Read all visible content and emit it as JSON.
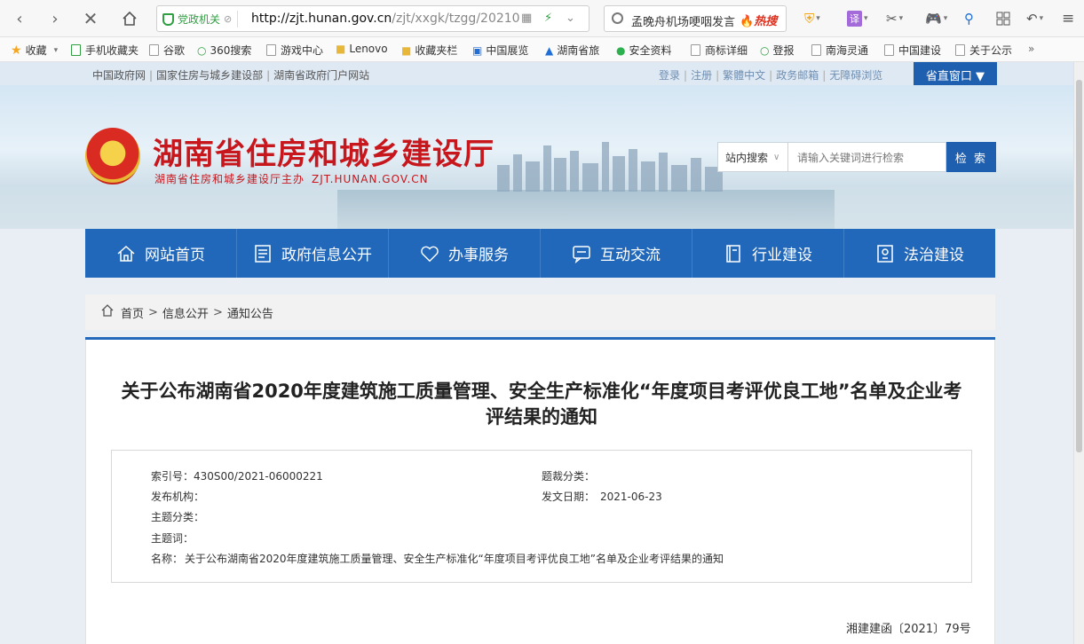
{
  "browser": {
    "address": {
      "badge": "党政机关",
      "url_host": "http://zjt.hunan.gov.cn",
      "url_path": "/zjt/xxgk/tzgg/20210"
    },
    "search": {
      "query": "孟晚舟机场哽咽发言",
      "hot_label": "热搜"
    },
    "tools": {
      "translate_label": "译"
    }
  },
  "bookmarks": [
    {
      "label": "收藏"
    },
    {
      "label": "手机收藏夹"
    },
    {
      "label": "谷歌"
    },
    {
      "label": "360搜索"
    },
    {
      "label": "游戏中心"
    },
    {
      "label": "Lenovo"
    },
    {
      "label": "收藏夹栏"
    },
    {
      "label": "中国展览"
    },
    {
      "label": "湖南省旅"
    },
    {
      "label": "安全资料"
    },
    {
      "label": "商标详细"
    },
    {
      "label": "登报"
    },
    {
      "label": "南海灵通"
    },
    {
      "label": "中国建设"
    },
    {
      "label": "关于公示"
    },
    {
      "label": "»"
    }
  ],
  "site": {
    "top_links": [
      "中国政府网",
      "国家住房与城乡建设部",
      "湖南省政府门户网站"
    ],
    "user_links": [
      "登录",
      "注册",
      "繁體中文",
      "政务邮箱",
      "无障碍浏览"
    ],
    "province_window": "省直窗口 ▼",
    "title": "湖南省住房和城乡建设厅",
    "subtitle": "湖南省住房和城乡建设厅主办",
    "domain": "ZJT.HUNAN.GOV.CN",
    "search": {
      "scope": "站内搜索",
      "placeholder": "请输入关键词进行检索",
      "button": "检 索"
    },
    "nav": [
      {
        "label": "网站首页",
        "icon": "home-icon"
      },
      {
        "label": "政府信息公开",
        "icon": "document-icon"
      },
      {
        "label": "办事服务",
        "icon": "heart-icon"
      },
      {
        "label": "互动交流",
        "icon": "chat-icon"
      },
      {
        "label": "行业建设",
        "icon": "book-icon"
      },
      {
        "label": "法治建设",
        "icon": "badge-icon"
      }
    ],
    "breadcrumb": [
      "首页",
      "信息公开",
      "通知公告"
    ]
  },
  "article": {
    "title": "关于公布湖南省2020年度建筑施工质量管理、安全生产标准化“年度项目考评优良工地”名单及企业考评结果的通知",
    "meta": {
      "index_label": "索引号：",
      "index_value": "430S00/2021-06000221",
      "category_label": "题裁分类：",
      "category_value": "",
      "publisher_label": "发布机构：",
      "publisher_value": "",
      "date_label": "发文日期：",
      "date_value": "2021-06-23",
      "topic_label": "主题分类：",
      "topic_value": "",
      "keywords_label": "主题词：",
      "keywords_value": "",
      "name_label": "名称：",
      "name_value": "关于公布湖南省2020年度建筑施工质量管理、安全生产标准化“年度项目考评优良工地”名单及企业考评结果的通知"
    },
    "doc_number": "湘建建函〔2021〕79号"
  }
}
